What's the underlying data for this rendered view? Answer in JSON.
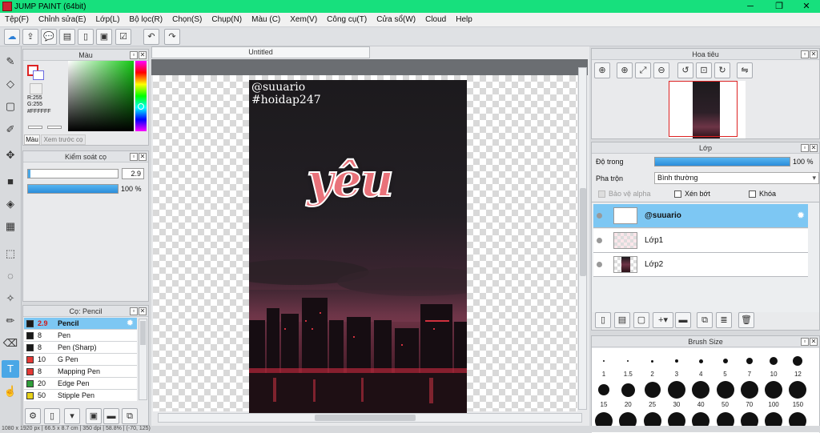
{
  "window": {
    "title": "JUMP PAINT (64bit)",
    "minimize": "─",
    "maximize": "❐",
    "close": "✕"
  },
  "menu": [
    "Tệp(F)",
    "Chỉnh sửa(E)",
    "Lớp(L)",
    "Bộ lọc(R)",
    "Chọn(S)",
    "Chụp(N)",
    "Màu (C)",
    "Xem(V)",
    "Công cụ(T)",
    "Cửa sổ(W)",
    "Cloud",
    "Help"
  ],
  "document": {
    "tab": "Untitled"
  },
  "color_panel": {
    "title": "Màu",
    "r": "R:255",
    "g": "G:255",
    "hex": "#FFFFFF",
    "tab_color": "Màu",
    "tab_preview": "Xem trước cọ"
  },
  "brush_control": {
    "title": "Kiểm soát cọ",
    "size": "2.9",
    "opacity": "100 %"
  },
  "brush_list": {
    "title": "Cọ: Pencil",
    "items": [
      {
        "size": "2.9",
        "name": "Pencil",
        "color": "#1a1a1a"
      },
      {
        "size": "8",
        "name": "Pen",
        "color": "#1a1a1a"
      },
      {
        "size": "8",
        "name": "Pen (Sharp)",
        "color": "#1a1a1a"
      },
      {
        "size": "10",
        "name": "G Pen",
        "color": "#e53935"
      },
      {
        "size": "8",
        "name": "Mapping Pen",
        "color": "#e53935"
      },
      {
        "size": "20",
        "name": "Edge Pen",
        "color": "#2e9e3a"
      },
      {
        "size": "50",
        "name": "Stipple Pen",
        "color": "#e8d21a"
      }
    ]
  },
  "navigator": {
    "title": "Hoa tiêu"
  },
  "layer_panel": {
    "title": "Lớp",
    "opacity_label": "Độ trong",
    "opacity_value": "100 %",
    "blend_label": "Pha trộn",
    "blend_value": "Bình thường",
    "protect_alpha": "Bảo vệ alpha",
    "clipping": "Xén bớt",
    "lock": "Khóa",
    "layers": [
      {
        "name": "@suuario",
        "selected": true
      },
      {
        "name": "Lớp1",
        "selected": false
      },
      {
        "name": "Lớp2",
        "selected": false
      }
    ]
  },
  "brush_size": {
    "title": "Brush Size",
    "labels": [
      "1",
      "1.5",
      "2",
      "3",
      "4",
      "5",
      "7",
      "10",
      "12",
      "15",
      "20",
      "25",
      "30",
      "40",
      "50",
      "70",
      "100",
      "150"
    ]
  },
  "artwork": {
    "handle": "@suuario",
    "tag": "#hoidap247",
    "word": "yêu"
  },
  "status": "1080 x 1920 px  |  66.5 x 8.7 cm  |  350 dpi  |  58.8%  |  (-70, 125)"
}
